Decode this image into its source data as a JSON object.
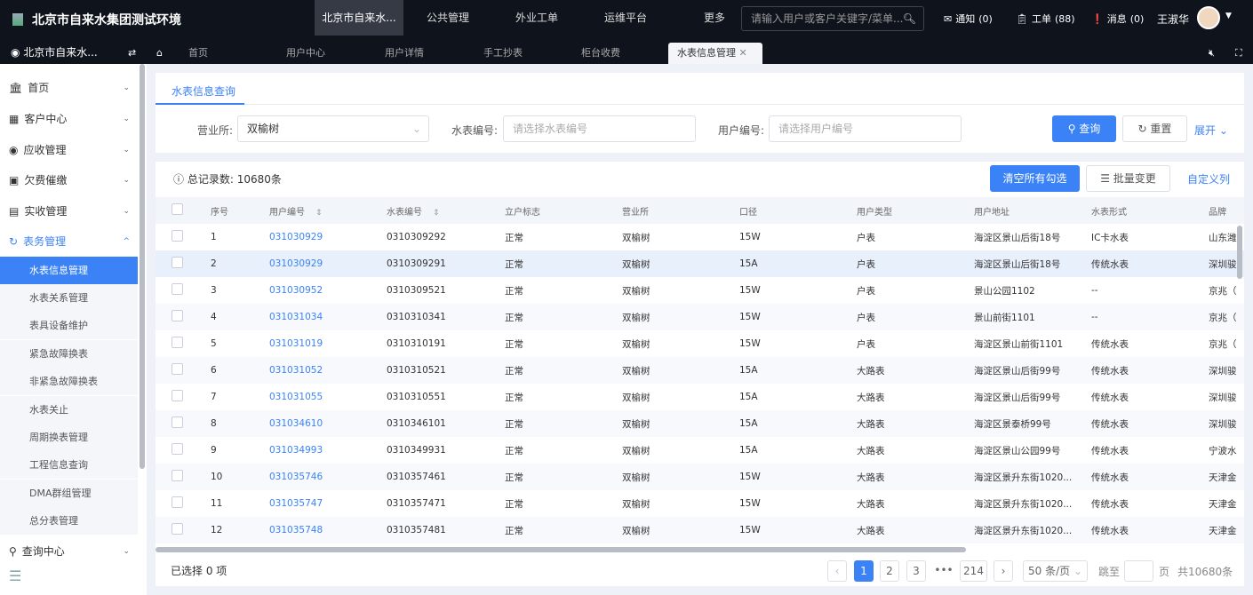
{
  "app": {
    "title": "北京市自来水集团测试环境",
    "logo_icon": "broken-image-icon"
  },
  "nav": {
    "items": [
      "北京市自来水...",
      "公共管理",
      "外业工单",
      "运维平台",
      "更多"
    ],
    "active": 0
  },
  "search": {
    "placeholder": "请输入用户或客户关键字/菜单..."
  },
  "header": {
    "notice": "通知",
    "notice_count": "(0)",
    "workorder": "工单",
    "workorder_count": "(88)",
    "message": "消息",
    "message_count": "(0)",
    "user": "王淑华"
  },
  "tabs": {
    "org": "北京市自来水...",
    "items": [
      "首页",
      "用户中心",
      "用户详情",
      "手工抄表",
      "柜台收费",
      "水表信息管理"
    ],
    "active": 5
  },
  "sidebar": {
    "items": [
      "首页",
      "客户中心",
      "应收管理",
      "欠费催缴",
      "实收管理",
      "表务管理"
    ],
    "sub": [
      "水表信息管理",
      "水表关系管理",
      "表具设备维护",
      "紧急故障换表",
      "非紧急故障换表",
      "水表关止",
      "周期换表管理",
      "工程信息查询",
      "DMA群组管理",
      "总分表管理"
    ],
    "bottom": "查询中心",
    "active_sub": 0
  },
  "query": {
    "tab": "水表信息查询",
    "office_label": "营业所:",
    "office_value": "双榆树",
    "meter_label": "水表编号:",
    "meter_placeholder": "请选择水表编号",
    "user_label": "用户编号:",
    "user_placeholder": "请选择用户编号",
    "search": "查询",
    "reset": "重置",
    "expand": "展开"
  },
  "toolbar": {
    "total": "总记录数: 10680条",
    "clear": "清空所有勾选",
    "batch": "批量变更",
    "custom": "自定义列"
  },
  "table": {
    "columns": [
      "序号",
      "用户编号",
      "水表编号",
      "立户标志",
      "营业所",
      "口径",
      "用户类型",
      "用户地址",
      "水表形式",
      "品牌"
    ],
    "rows": [
      [
        "1",
        "031030929",
        "0310309292",
        "正常",
        "双榆树",
        "15W",
        "户表",
        "海淀区景山后街18号",
        "IC卡水表",
        "山东潍"
      ],
      [
        "2",
        "031030929",
        "0310309291",
        "正常",
        "双榆树",
        "15A",
        "户表",
        "海淀区景山后街18号",
        "传统水表",
        "深圳骏"
      ],
      [
        "3",
        "031030952",
        "0310309521",
        "正常",
        "双榆树",
        "15W",
        "户表",
        "景山公园1102",
        "--",
        "京兆（"
      ],
      [
        "4",
        "031031034",
        "0310310341",
        "正常",
        "双榆树",
        "15W",
        "户表",
        "景山前街1101",
        "--",
        "京兆（"
      ],
      [
        "5",
        "031031019",
        "0310310191",
        "正常",
        "双榆树",
        "15W",
        "户表",
        "海淀区景山前街1101",
        "传统水表",
        "京兆（"
      ],
      [
        "6",
        "031031052",
        "0310310521",
        "正常",
        "双榆树",
        "15A",
        "大路表",
        "海淀区景山后街99号",
        "传统水表",
        "深圳骏"
      ],
      [
        "7",
        "031031055",
        "0310310551",
        "正常",
        "双榆树",
        "15A",
        "大路表",
        "海淀区景山后街99号",
        "传统水表",
        "深圳骏"
      ],
      [
        "8",
        "031034610",
        "0310346101",
        "正常",
        "双榆树",
        "15A",
        "大路表",
        "海淀区景泰桥99号",
        "传统水表",
        "深圳骏"
      ],
      [
        "9",
        "031034993",
        "0310349931",
        "正常",
        "双榆树",
        "15A",
        "大路表",
        "海淀区景山公园99号",
        "传统水表",
        "宁波水"
      ],
      [
        "10",
        "031035746",
        "0310357461",
        "正常",
        "双榆树",
        "15W",
        "大路表",
        "海淀区景升东街1020...",
        "传统水表",
        "天津金"
      ],
      [
        "11",
        "031035747",
        "0310357471",
        "正常",
        "双榆树",
        "15W",
        "大路表",
        "海淀区景升东街1020...",
        "传统水表",
        "天津金"
      ],
      [
        "12",
        "031035748",
        "0310357481",
        "正常",
        "双榆树",
        "15W",
        "大路表",
        "海淀区景升东街1020...",
        "传统水表",
        "天津金"
      ]
    ],
    "hover_row": 1
  },
  "footer": {
    "selected": "已选择 0 项",
    "pages": [
      "1",
      "2",
      "3",
      "•••",
      "214"
    ],
    "current": "1",
    "page_size": "50 条/页",
    "goto": "跳至",
    "page": "页",
    "total": "共10680条"
  },
  "colors": {
    "primary": "#3b82f6",
    "topbar": "#0e131c"
  }
}
